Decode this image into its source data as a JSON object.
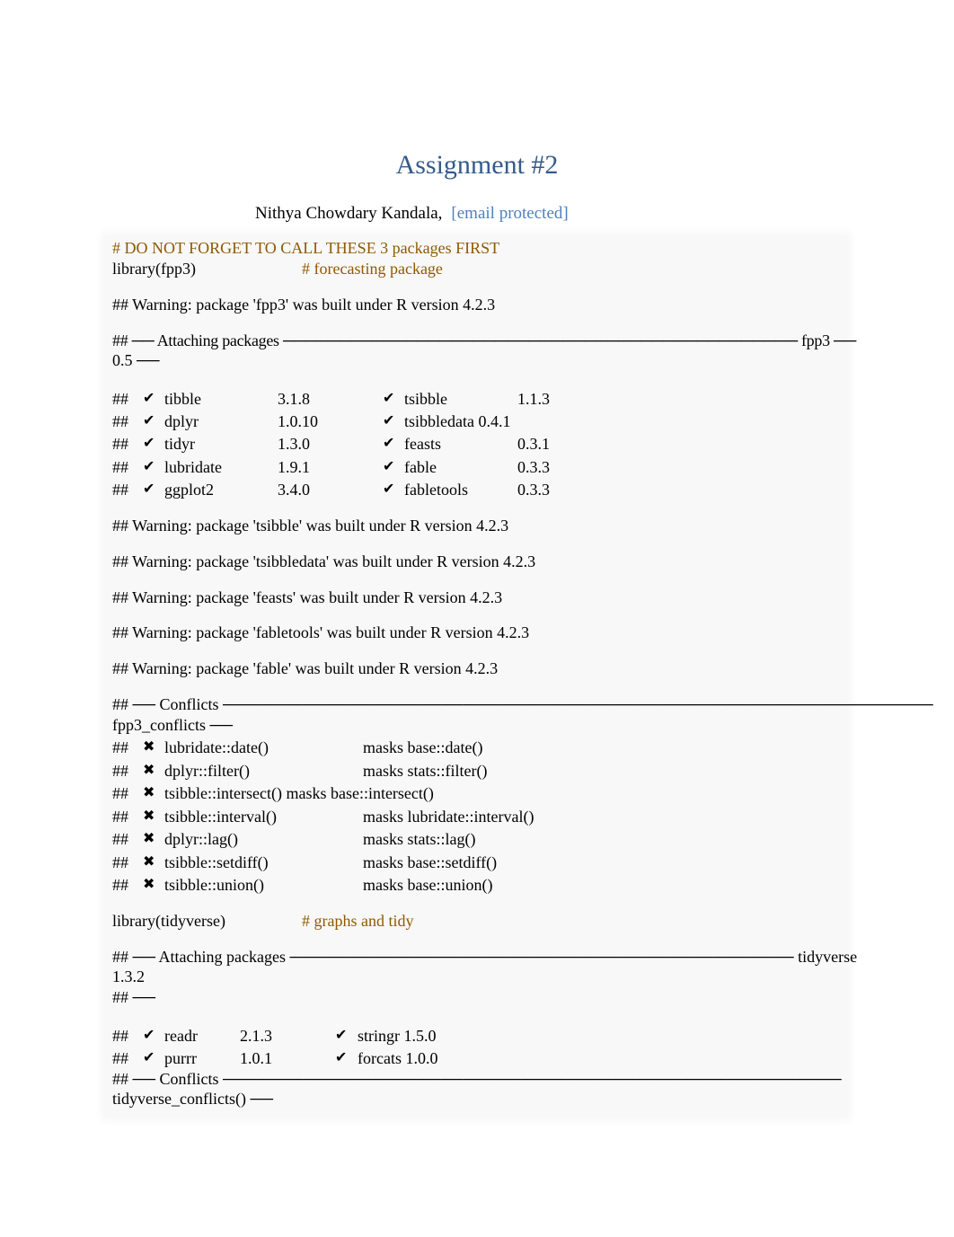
{
  "header": {
    "title": "Assignment #2",
    "author": "Nithya Chowdary Kandala,",
    "email": "[email protected]"
  },
  "code": {
    "comment_first": "# DO NOT FORGET TO CALL THESE 3 packages FIRST",
    "lib_fpp3": "library(fpp3)",
    "lib_fpp3_comment": "# forecasting package",
    "warn_fpp3": "## Warning: package 'fpp3' was built under R version 4.2.3",
    "attach_fpp3_line1": "## ── Attaching packages ────────────────────────────────────────────── fpp3 ──",
    "attach_fpp3_line2": "0.5 ──",
    "fpp3_packages": [
      {
        "prefix": "##",
        "mark": "✔",
        "name": "tibble",
        "version": "3.1.8",
        "mark2": "✔",
        "name2": "tsibble",
        "version2": "1.1.3"
      },
      {
        "prefix": "##",
        "mark": "✔",
        "name": "dplyr",
        "version": "1.0.10",
        "mark2": "✔",
        "name2": "tsibbledata 0.4.1",
        "version2": ""
      },
      {
        "prefix": "##",
        "mark": "✔",
        "name": "tidyr",
        "version": "1.3.0",
        "mark2": "✔",
        "name2": "feasts",
        "version2": "0.3.1"
      },
      {
        "prefix": "##",
        "mark": "✔",
        "name": "lubridate",
        "version": "1.9.1",
        "mark2": "✔",
        "name2": "fable",
        "version2": "0.3.3"
      },
      {
        "prefix": "##",
        "mark": "✔",
        "name": "ggplot2",
        "version": "3.4.0",
        "mark2": "✔",
        "name2": "fabletools",
        "version2": "0.3.3"
      }
    ],
    "warnings": [
      "## Warning: package 'tsibble' was built under R version 4.2.3",
      "## Warning: package 'tsibbledata' was built under R version 4.2.3",
      "## Warning: package 'feasts' was built under R version 4.2.3",
      "## Warning: package 'fabletools' was built under R version 4.2.3",
      "## Warning: package 'fable' was built under R version 4.2.3"
    ],
    "conflicts_fpp3_line1": "## ── Conflicts ──────────────────────────────────────────────────────────────",
    "conflicts_fpp3_line2": "fpp3_conflicts ──",
    "fpp3_conflicts": [
      {
        "prefix": "##",
        "mark": "✖",
        "func": "lubridate::date()",
        "masks": "masks base::date()"
      },
      {
        "prefix": "##",
        "mark": "✖",
        "func": "dplyr::filter()",
        "masks": "masks stats::filter()"
      },
      {
        "prefix": "##",
        "mark": "✖",
        "func": "tsibble::intersect() masks base::intersect()",
        "masks": ""
      },
      {
        "prefix": "##",
        "mark": "✖",
        "func": "tsibble::interval()",
        "masks": "masks lubridate::interval()"
      },
      {
        "prefix": "##",
        "mark": "✖",
        "func": "dplyr::lag()",
        "masks": "masks stats::lag()"
      },
      {
        "prefix": "##",
        "mark": "✖",
        "func": "tsibble::setdiff()",
        "masks": "masks base::setdiff()"
      },
      {
        "prefix": "##",
        "mark": "✖",
        "func": "tsibble::union()",
        "masks": "masks base::union()"
      }
    ],
    "lib_tidyverse": "library(tidyverse)",
    "lib_tidyverse_comment": "# graphs and tidy",
    "attach_tidy_line1": "## ── Attaching packages ──────────────────────────────────────────── tidyverse",
    "attach_tidy_line2": "1.3.2",
    "attach_tidy_line3": "## ──",
    "tidy_packages": [
      {
        "prefix": "##",
        "mark": "✔",
        "name": "readr",
        "version": "2.1.3",
        "mark2": "✔",
        "name2": "stringr 1.5.0"
      },
      {
        "prefix": "##",
        "mark": "✔",
        "name": "purrr",
        "version": "1.0.1",
        "mark2": "✔",
        "name2": "forcats 1.0.0"
      }
    ],
    "conflicts_tidy_line1": "## ── Conflicts ──────────────────────────────────────────────────────",
    "conflicts_tidy_line2": "tidyverse_conflicts() ──"
  },
  "colors": {
    "title": "#345a8a",
    "email": "#4f81bd",
    "comment": "#8f5902",
    "code_bg": "#f8f8f8"
  }
}
